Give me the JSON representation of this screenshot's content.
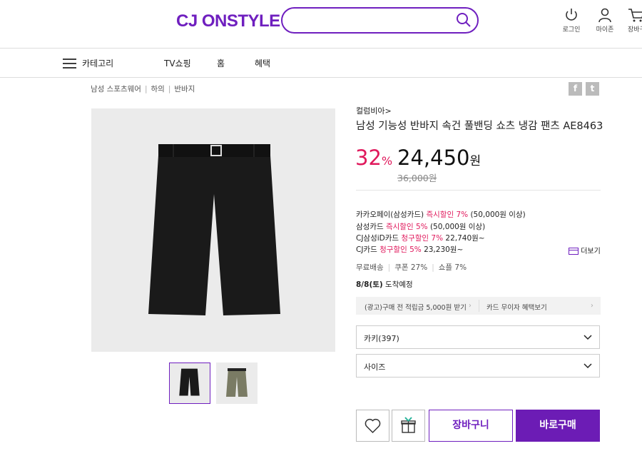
{
  "header": {
    "logo": "CJ ONSTYLE",
    "search": {
      "placeholder": ""
    },
    "icons": [
      {
        "label": "로그인",
        "icon": "power-icon"
      },
      {
        "label": "마이존",
        "icon": "user-icon"
      },
      {
        "label": "장바구",
        "icon": "cart-icon"
      }
    ]
  },
  "nav": {
    "category": "카테고리",
    "items": [
      "TV쇼핑",
      "홈",
      "혜택"
    ]
  },
  "breadcrumb": [
    "남성 스포츠웨어",
    "하의",
    "반바지"
  ],
  "share": {
    "facebook": "f",
    "twitter": "t"
  },
  "product": {
    "brand": "컬럼비아>",
    "title": "남성 기능성 반바지 속건 풀밴딩 쇼츠 냉감 팬츠 AE8463",
    "discount": "32",
    "discount_unit": "%",
    "price": "24,450",
    "price_unit": "원",
    "original_price": "36,000원",
    "benefits": [
      {
        "pre": "카카오페이(삼성카드) ",
        "hi": "즉시할인 7%",
        "post": " (50,000원 이상)"
      },
      {
        "pre": "삼성카드 ",
        "hi": "즉시할인 5%",
        "post": " (50,000원 이상)"
      },
      {
        "pre": "CJ삼성iD카드 ",
        "hi": "청구할인 7%",
        "post": " 22,740원~"
      },
      {
        "pre": "CJ카드 ",
        "hi": "청구할인 5%",
        "post": " 23,230원~"
      }
    ],
    "more": "더보기",
    "shipping": [
      "무료배송",
      "쿠폰 27%",
      "쇼플 7%"
    ],
    "delivery_date": "8/8(토)",
    "delivery_text": " 도착예정",
    "ads": [
      "(광고)구매 전 적립금 5,000원 받기",
      "카드 무이자 혜택보기"
    ],
    "color_option": "카키(397)",
    "size_option": "사이즈",
    "cart_label": "장바구니",
    "buy_label": "바로구매"
  },
  "colors": {
    "brand": "#6f1fbf",
    "sale": "#e0195c",
    "thumb_khaki": "#7a7b64",
    "shorts": "#1a1a1a"
  }
}
